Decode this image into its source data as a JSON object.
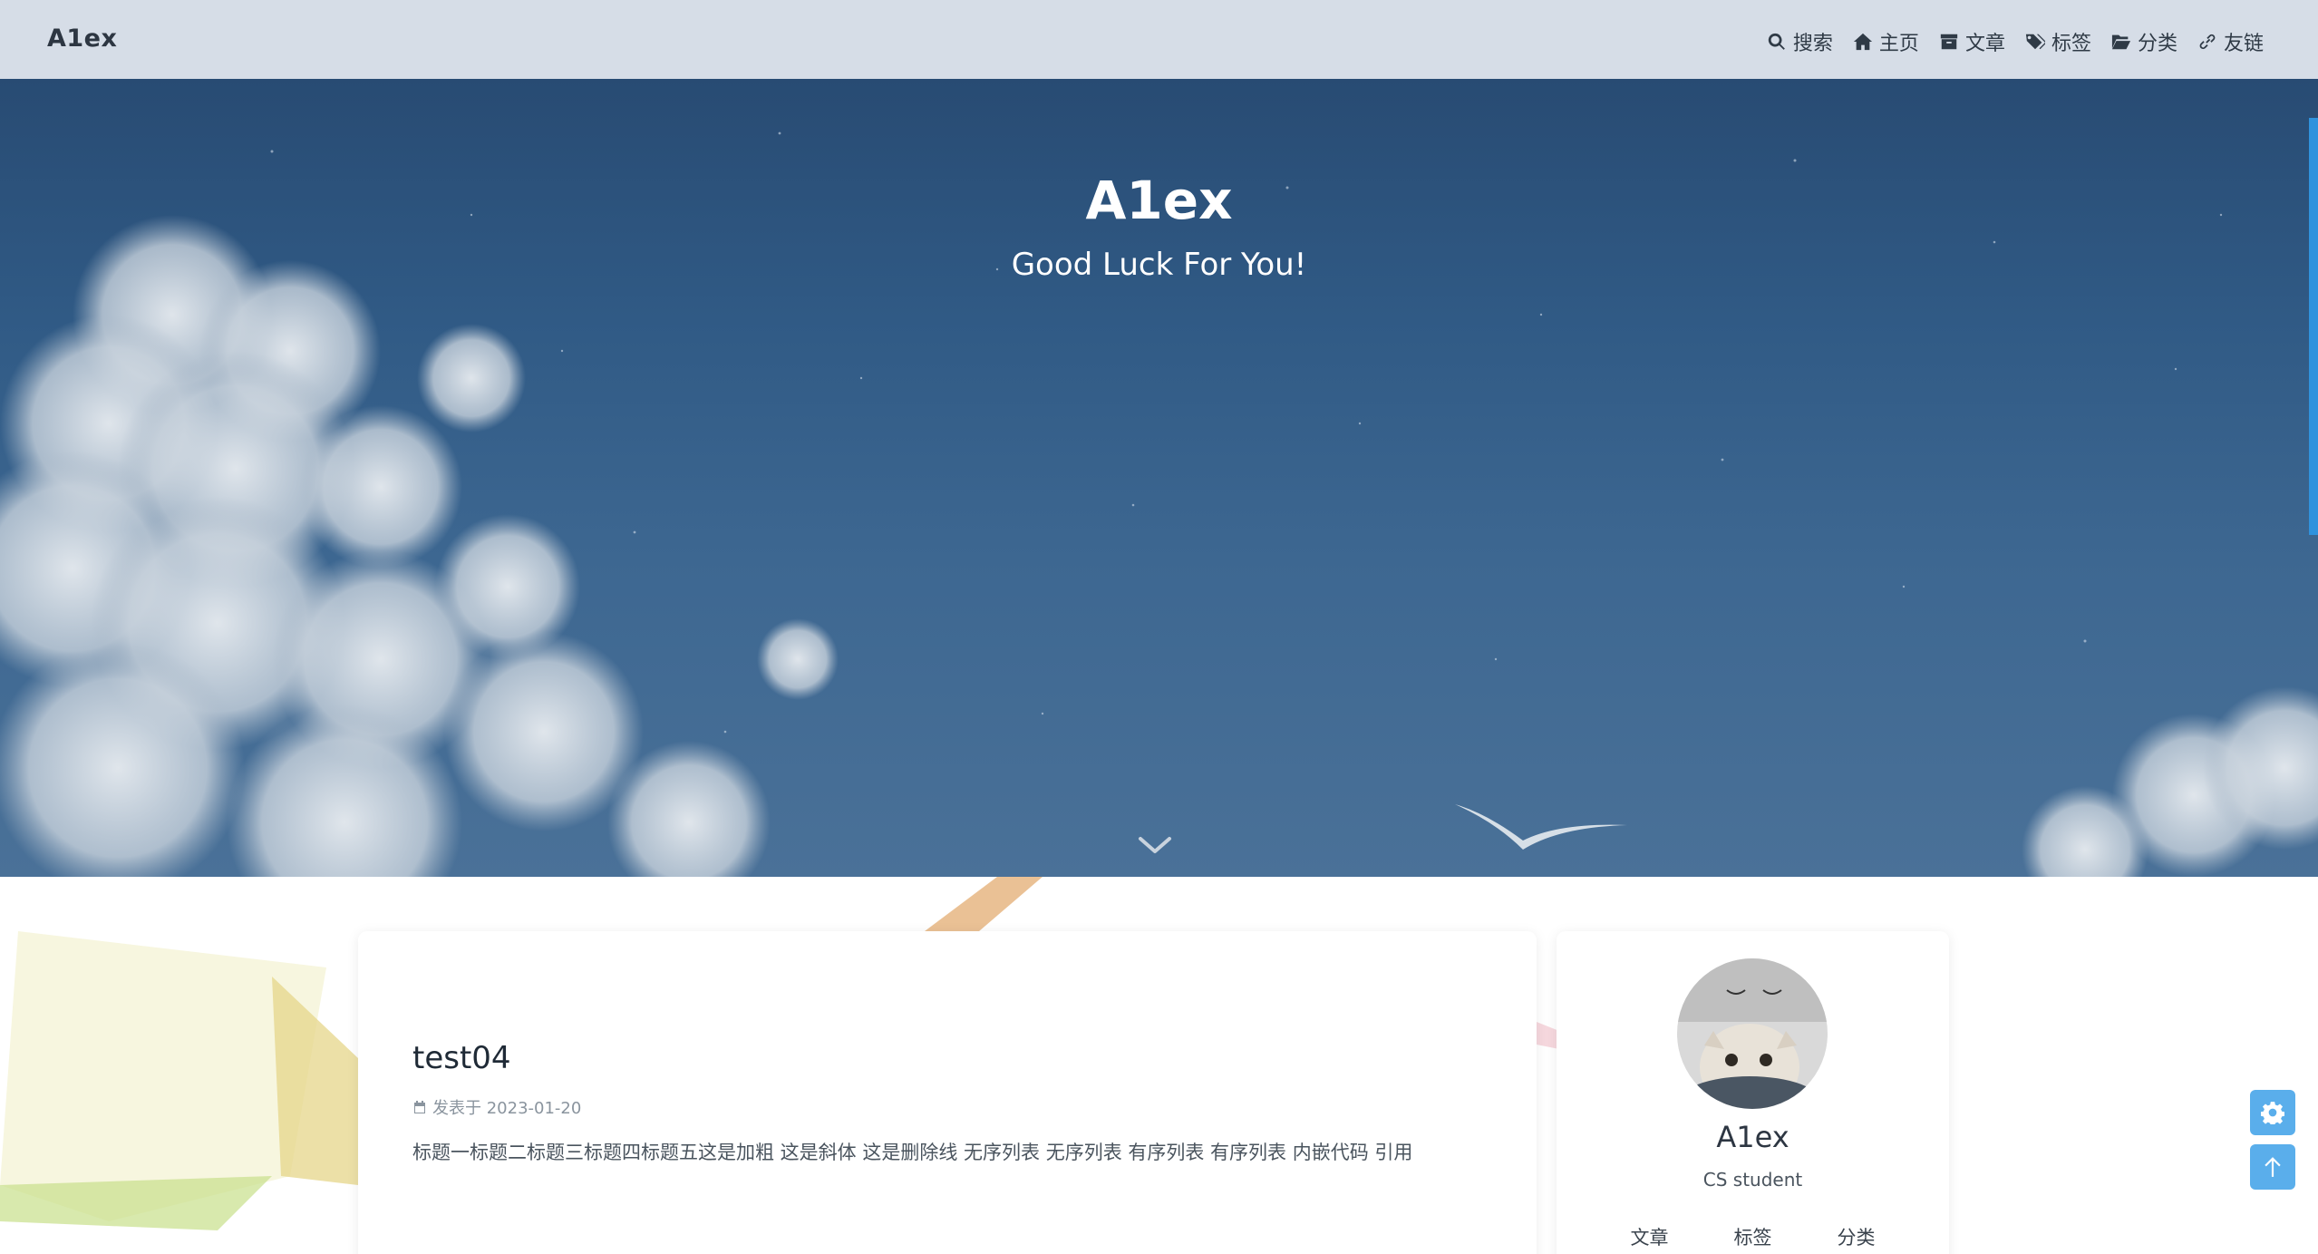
{
  "navbar": {
    "brand": "A1ex",
    "items": [
      {
        "label": "搜索",
        "icon": "search-icon"
      },
      {
        "label": "主页",
        "icon": "home-icon"
      },
      {
        "label": "文章",
        "icon": "archive-icon"
      },
      {
        "label": "标签",
        "icon": "tags-icon"
      },
      {
        "label": "分类",
        "icon": "folder-open-icon"
      },
      {
        "label": "友链",
        "icon": "link-icon"
      }
    ]
  },
  "hero": {
    "title": "A1ex",
    "subtitle": "Good Luck For You!"
  },
  "post": {
    "title": "test04",
    "meta": "发表于 2023-01-20",
    "excerpt": "标题一标题二标题三标题四标题五这是加粗 这是斜体 这是删除线 无序列表 无序列表 有序列表 有序列表 内嵌代码 引用"
  },
  "profile": {
    "name": "A1ex",
    "description": "CS student",
    "stats": [
      "文章",
      "标签",
      "分类"
    ]
  },
  "floating_buttons": {
    "settings": "gear-icon",
    "back_to_top": "arrow-up-icon"
  },
  "colors": {
    "navbar_bg": "#d6dde7",
    "accent": "#5aaeeb",
    "scrollbar": "#2f92dd"
  }
}
